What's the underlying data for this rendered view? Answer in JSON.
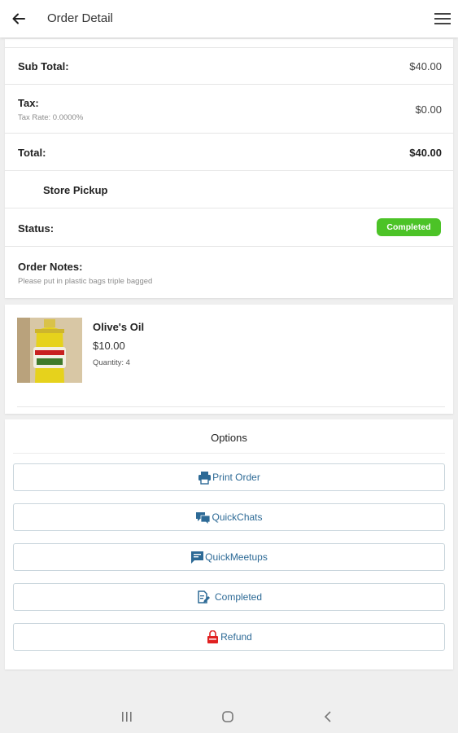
{
  "header": {
    "title": "Order Detail",
    "back_icon": "arrow-left-icon",
    "menu_icon": "hamburger-menu-icon"
  },
  "summary": {
    "subtotal_label": "Sub Total:",
    "subtotal_value": "$40.00",
    "tax_label": "Tax:",
    "tax_rate": "Tax Rate: 0.0000%",
    "tax_value": "$0.00",
    "total_label": "Total:",
    "total_value": "$40.00",
    "fulfillment": "Store Pickup",
    "status_label": "Status:",
    "status_value": "Completed",
    "notes_label": "Order Notes:",
    "notes_value": "Please put in plastic bags triple bagged"
  },
  "item": {
    "name": "Olive's Oil",
    "price": "$10.00",
    "quantity": "Quantity: 4",
    "image_icon": "olive-oil-bottle-image"
  },
  "options": {
    "title": "Options",
    "buttons": [
      {
        "label": "Print Order",
        "icon": "printer-icon"
      },
      {
        "label": "QuickChats",
        "icon": "chat-bubbles-icon"
      },
      {
        "label": "QuickMeetups",
        "icon": "message-icon"
      },
      {
        "label": "Completed",
        "icon": "edit-document-icon"
      },
      {
        "label": "Refund",
        "icon": "refund-icon"
      }
    ]
  },
  "colors": {
    "status_green": "#4cc327",
    "link_blue": "#2d6a96",
    "refund_red": "#e02020"
  }
}
